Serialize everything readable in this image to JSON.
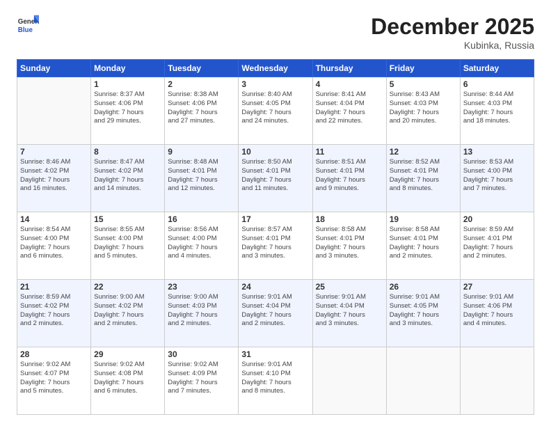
{
  "header": {
    "logo_general": "General",
    "logo_blue": "Blue",
    "month_title": "December 2025",
    "subtitle": "Kubinka, Russia"
  },
  "days_of_week": [
    "Sunday",
    "Monday",
    "Tuesday",
    "Wednesday",
    "Thursday",
    "Friday",
    "Saturday"
  ],
  "weeks": [
    [
      {
        "day": "",
        "info": ""
      },
      {
        "day": "1",
        "info": "Sunrise: 8:37 AM\nSunset: 4:06 PM\nDaylight: 7 hours\nand 29 minutes."
      },
      {
        "day": "2",
        "info": "Sunrise: 8:38 AM\nSunset: 4:06 PM\nDaylight: 7 hours\nand 27 minutes."
      },
      {
        "day": "3",
        "info": "Sunrise: 8:40 AM\nSunset: 4:05 PM\nDaylight: 7 hours\nand 24 minutes."
      },
      {
        "day": "4",
        "info": "Sunrise: 8:41 AM\nSunset: 4:04 PM\nDaylight: 7 hours\nand 22 minutes."
      },
      {
        "day": "5",
        "info": "Sunrise: 8:43 AM\nSunset: 4:03 PM\nDaylight: 7 hours\nand 20 minutes."
      },
      {
        "day": "6",
        "info": "Sunrise: 8:44 AM\nSunset: 4:03 PM\nDaylight: 7 hours\nand 18 minutes."
      }
    ],
    [
      {
        "day": "7",
        "info": "Sunrise: 8:46 AM\nSunset: 4:02 PM\nDaylight: 7 hours\nand 16 minutes."
      },
      {
        "day": "8",
        "info": "Sunrise: 8:47 AM\nSunset: 4:02 PM\nDaylight: 7 hours\nand 14 minutes."
      },
      {
        "day": "9",
        "info": "Sunrise: 8:48 AM\nSunset: 4:01 PM\nDaylight: 7 hours\nand 12 minutes."
      },
      {
        "day": "10",
        "info": "Sunrise: 8:50 AM\nSunset: 4:01 PM\nDaylight: 7 hours\nand 11 minutes."
      },
      {
        "day": "11",
        "info": "Sunrise: 8:51 AM\nSunset: 4:01 PM\nDaylight: 7 hours\nand 9 minutes."
      },
      {
        "day": "12",
        "info": "Sunrise: 8:52 AM\nSunset: 4:01 PM\nDaylight: 7 hours\nand 8 minutes."
      },
      {
        "day": "13",
        "info": "Sunrise: 8:53 AM\nSunset: 4:00 PM\nDaylight: 7 hours\nand 7 minutes."
      }
    ],
    [
      {
        "day": "14",
        "info": "Sunrise: 8:54 AM\nSunset: 4:00 PM\nDaylight: 7 hours\nand 6 minutes."
      },
      {
        "day": "15",
        "info": "Sunrise: 8:55 AM\nSunset: 4:00 PM\nDaylight: 7 hours\nand 5 minutes."
      },
      {
        "day": "16",
        "info": "Sunrise: 8:56 AM\nSunset: 4:00 PM\nDaylight: 7 hours\nand 4 minutes."
      },
      {
        "day": "17",
        "info": "Sunrise: 8:57 AM\nSunset: 4:01 PM\nDaylight: 7 hours\nand 3 minutes."
      },
      {
        "day": "18",
        "info": "Sunrise: 8:58 AM\nSunset: 4:01 PM\nDaylight: 7 hours\nand 3 minutes."
      },
      {
        "day": "19",
        "info": "Sunrise: 8:58 AM\nSunset: 4:01 PM\nDaylight: 7 hours\nand 2 minutes."
      },
      {
        "day": "20",
        "info": "Sunrise: 8:59 AM\nSunset: 4:01 PM\nDaylight: 7 hours\nand 2 minutes."
      }
    ],
    [
      {
        "day": "21",
        "info": "Sunrise: 8:59 AM\nSunset: 4:02 PM\nDaylight: 7 hours\nand 2 minutes."
      },
      {
        "day": "22",
        "info": "Sunrise: 9:00 AM\nSunset: 4:02 PM\nDaylight: 7 hours\nand 2 minutes."
      },
      {
        "day": "23",
        "info": "Sunrise: 9:00 AM\nSunset: 4:03 PM\nDaylight: 7 hours\nand 2 minutes."
      },
      {
        "day": "24",
        "info": "Sunrise: 9:01 AM\nSunset: 4:04 PM\nDaylight: 7 hours\nand 2 minutes."
      },
      {
        "day": "25",
        "info": "Sunrise: 9:01 AM\nSunset: 4:04 PM\nDaylight: 7 hours\nand 3 minutes."
      },
      {
        "day": "26",
        "info": "Sunrise: 9:01 AM\nSunset: 4:05 PM\nDaylight: 7 hours\nand 3 minutes."
      },
      {
        "day": "27",
        "info": "Sunrise: 9:01 AM\nSunset: 4:06 PM\nDaylight: 7 hours\nand 4 minutes."
      }
    ],
    [
      {
        "day": "28",
        "info": "Sunrise: 9:02 AM\nSunset: 4:07 PM\nDaylight: 7 hours\nand 5 minutes."
      },
      {
        "day": "29",
        "info": "Sunrise: 9:02 AM\nSunset: 4:08 PM\nDaylight: 7 hours\nand 6 minutes."
      },
      {
        "day": "30",
        "info": "Sunrise: 9:02 AM\nSunset: 4:09 PM\nDaylight: 7 hours\nand 7 minutes."
      },
      {
        "day": "31",
        "info": "Sunrise: 9:01 AM\nSunset: 4:10 PM\nDaylight: 7 hours\nand 8 minutes."
      },
      {
        "day": "",
        "info": ""
      },
      {
        "day": "",
        "info": ""
      },
      {
        "day": "",
        "info": ""
      }
    ]
  ]
}
